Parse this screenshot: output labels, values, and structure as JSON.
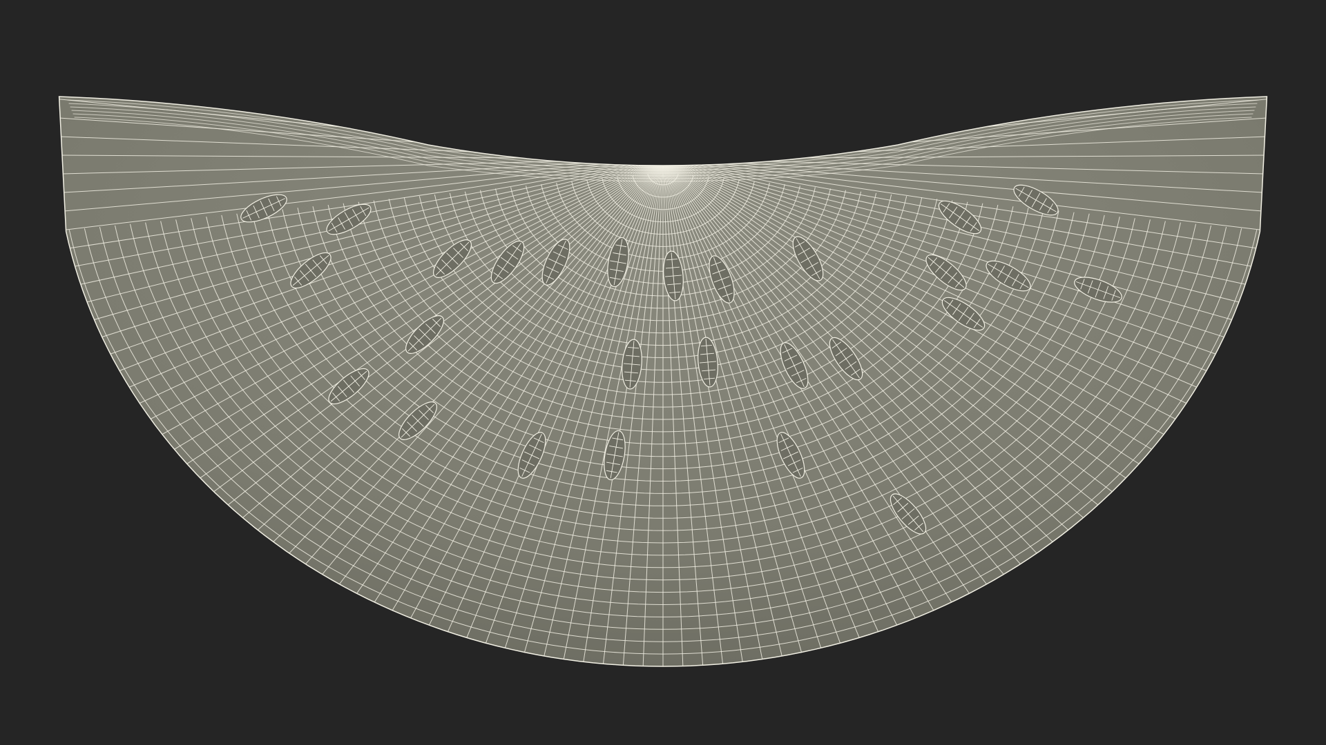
{
  "scene": {
    "background_color": "#252525",
    "surface_color": "#7d7d71",
    "wire_color": "#f2f0e4",
    "seed_color": "#6e6e63",
    "shading": "wireframe-on-shaded",
    "subject_icon": "watermelon-slice-icon"
  },
  "mesh": {
    "radial_lines": 96,
    "concentric_rings": 40,
    "rind_rings": 6
  }
}
